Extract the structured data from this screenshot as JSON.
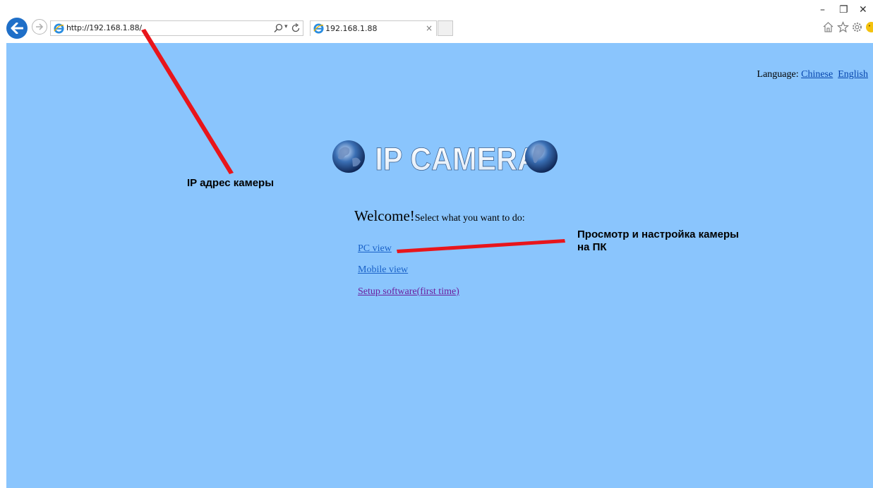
{
  "browser": {
    "address": "http://192.168.1.88/",
    "tab_title": "192.168.1.88",
    "tab_close": "×",
    "dropdown_glyph": "▾",
    "minimize": "–",
    "restore": "❐",
    "close": "✕"
  },
  "page": {
    "language_label": "Language:",
    "languages": [
      "Chinese",
      "English"
    ],
    "logo_text": "IP CAMERA",
    "welcome_big": "Welcome!",
    "welcome_small": "Select what you want to do:",
    "links": [
      "PC view",
      "Mobile view",
      "Setup software(first time)"
    ]
  },
  "annotations": {
    "ip_address": "IP адрес камеры",
    "pc_view_line1": "Просмотр и настройка камеры",
    "pc_view_line2": "на ПК"
  },
  "colors": {
    "page_background": "#8ac5fd",
    "link": "#1a62c8",
    "visited_link": "#6b1f9e",
    "annotation_arrow": "#e8151b",
    "back_button": "#1f6fc8"
  }
}
